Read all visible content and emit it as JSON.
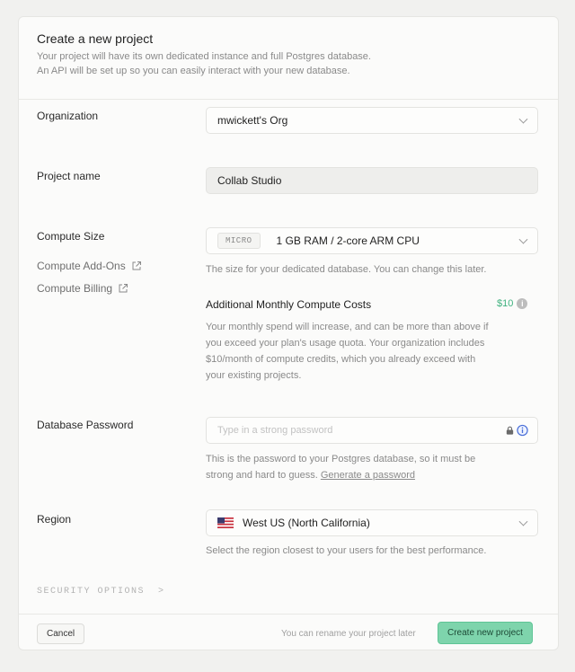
{
  "header": {
    "title": "Create a new project",
    "description_line1": "Your project will have its own dedicated instance and full Postgres database.",
    "description_line2": "An API will be set up so you can easily interact with your new database."
  },
  "organization": {
    "label": "Organization",
    "value": "mwickett's Org"
  },
  "project_name": {
    "label": "Project name",
    "value": "Collab Studio"
  },
  "compute": {
    "label": "Compute Size",
    "badge": "MICRO",
    "value": "1 GB RAM / 2-core ARM CPU",
    "help": "The size for your dedicated database. You can change this later.",
    "addons_link": "Compute Add-Ons",
    "billing_link": "Compute Billing",
    "cost_title": "Additional Monthly Compute Costs",
    "cost_value": "$10",
    "cost_help_line1": "Your monthly spend will increase, and can be more than above if",
    "cost_help_line2": "you exceed your plan's usage quota. Your organization includes",
    "cost_help_line3": "$10/month of compute credits, which you already exceed with",
    "cost_help_line4": "your existing projects."
  },
  "password": {
    "label": "Database Password",
    "placeholder": "Type in a strong password",
    "help_line1": "This is the password to your Postgres database, so it must be",
    "help_prefix": "strong and hard to guess. ",
    "generate_link": "Generate a password"
  },
  "region": {
    "label": "Region",
    "value": "West US (North California)",
    "help": "Select the region closest to your users for the best performance."
  },
  "security_options": "SECURITY OPTIONS",
  "footer": {
    "cancel_label": "Cancel",
    "rename_note": "You can rename your project later",
    "create_label": "Create new project"
  },
  "colors": {
    "accent_green": "#7ed4ac",
    "cost_green": "#3fb27f"
  }
}
